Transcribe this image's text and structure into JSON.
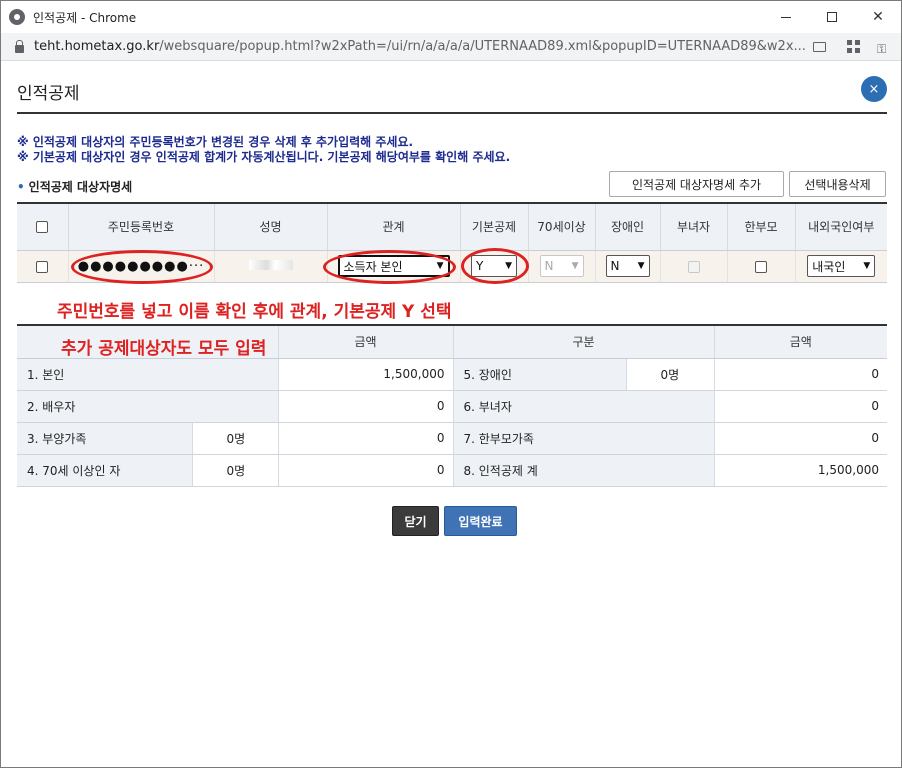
{
  "window": {
    "title": "인적공제 - Chrome"
  },
  "address": {
    "host": "teht.hometax.go.kr",
    "path": "/websquare/popup.html?w2xPath=/ui/rn/a/a/a/a/UTERNAAD89.xml&popupID=UTERNAAD89&w2x..."
  },
  "popup": {
    "title": "인적공제",
    "close_label": "×",
    "notices": [
      "※ 인적공제 대상자의 주민등록번호가 변경된 경우 삭제 후 추가입력해 주세요.",
      "※ 기본공제 대상자인 경우 인적공제 합계가 자동계산됩니다. 기본공제 해당여부를 확인해 주세요."
    ],
    "section_title": "인적공제 대상자명세",
    "add_button": "인적공제 대상자명세 추가",
    "delete_button": "선택내용삭제"
  },
  "list": {
    "headers": [
      "주민등록번호",
      "성명",
      "관계",
      "기본공제",
      "70세이상",
      "장애인",
      "부녀자",
      "한부모",
      "내외국인여부"
    ],
    "row": {
      "ssn_masked": "●●●●●●●●●···",
      "relation": "소득자 본인",
      "basic": "Y",
      "over70": "N",
      "disabled": "N",
      "foreign": "내국인"
    }
  },
  "annotations": {
    "line1": "주민번호를 넣고 이름 확인 후에 관계, 기본공제 Y 선택",
    "line2": "추가 공제대상자도 모두 입력"
  },
  "summary": {
    "headers": [
      "금액",
      "구분",
      "금액"
    ],
    "rows": [
      {
        "l_label": "1. 본인",
        "l_count": "",
        "l_amount": "1,500,000",
        "r_label": "5. 장애인",
        "r_count": "0명",
        "r_amount": "0"
      },
      {
        "l_label": "2. 배우자",
        "l_count": "",
        "l_amount": "0",
        "r_label": "6. 부녀자",
        "r_count": "",
        "r_amount": "0"
      },
      {
        "l_label": "3. 부양가족",
        "l_count": "0명",
        "l_amount": "0",
        "r_label": "7. 한부모가족",
        "r_count": "",
        "r_amount": "0"
      },
      {
        "l_label": "4. 70세 이상인 자",
        "l_count": "0명",
        "l_amount": "0",
        "r_label": "8. 인적공제 계",
        "r_count": "",
        "r_amount": "1,500,000"
      }
    ]
  },
  "buttons": {
    "close": "닫기",
    "done": "입력완료"
  },
  "colors": {
    "accent": "#2c6db3",
    "annotation": "#dd2222",
    "notice": "#1d2b8f"
  }
}
